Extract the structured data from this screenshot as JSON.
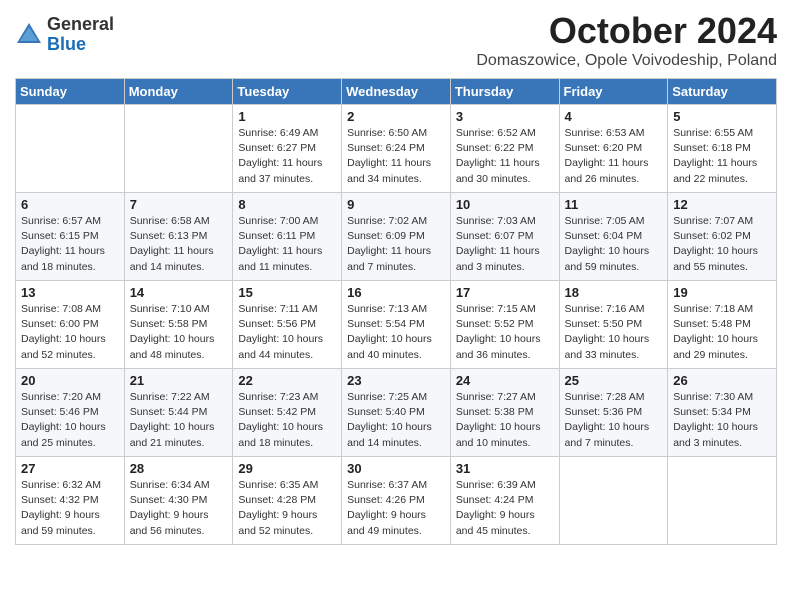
{
  "header": {
    "logo_general": "General",
    "logo_blue": "Blue",
    "month": "October 2024",
    "location": "Domaszowice, Opole Voivodeship, Poland"
  },
  "days_of_week": [
    "Sunday",
    "Monday",
    "Tuesday",
    "Wednesday",
    "Thursday",
    "Friday",
    "Saturday"
  ],
  "weeks": [
    [
      {
        "day": "",
        "info": ""
      },
      {
        "day": "",
        "info": ""
      },
      {
        "day": "1",
        "info": "Sunrise: 6:49 AM\nSunset: 6:27 PM\nDaylight: 11 hours and 37 minutes."
      },
      {
        "day": "2",
        "info": "Sunrise: 6:50 AM\nSunset: 6:24 PM\nDaylight: 11 hours and 34 minutes."
      },
      {
        "day": "3",
        "info": "Sunrise: 6:52 AM\nSunset: 6:22 PM\nDaylight: 11 hours and 30 minutes."
      },
      {
        "day": "4",
        "info": "Sunrise: 6:53 AM\nSunset: 6:20 PM\nDaylight: 11 hours and 26 minutes."
      },
      {
        "day": "5",
        "info": "Sunrise: 6:55 AM\nSunset: 6:18 PM\nDaylight: 11 hours and 22 minutes."
      }
    ],
    [
      {
        "day": "6",
        "info": "Sunrise: 6:57 AM\nSunset: 6:15 PM\nDaylight: 11 hours and 18 minutes."
      },
      {
        "day": "7",
        "info": "Sunrise: 6:58 AM\nSunset: 6:13 PM\nDaylight: 11 hours and 14 minutes."
      },
      {
        "day": "8",
        "info": "Sunrise: 7:00 AM\nSunset: 6:11 PM\nDaylight: 11 hours and 11 minutes."
      },
      {
        "day": "9",
        "info": "Sunrise: 7:02 AM\nSunset: 6:09 PM\nDaylight: 11 hours and 7 minutes."
      },
      {
        "day": "10",
        "info": "Sunrise: 7:03 AM\nSunset: 6:07 PM\nDaylight: 11 hours and 3 minutes."
      },
      {
        "day": "11",
        "info": "Sunrise: 7:05 AM\nSunset: 6:04 PM\nDaylight: 10 hours and 59 minutes."
      },
      {
        "day": "12",
        "info": "Sunrise: 7:07 AM\nSunset: 6:02 PM\nDaylight: 10 hours and 55 minutes."
      }
    ],
    [
      {
        "day": "13",
        "info": "Sunrise: 7:08 AM\nSunset: 6:00 PM\nDaylight: 10 hours and 52 minutes."
      },
      {
        "day": "14",
        "info": "Sunrise: 7:10 AM\nSunset: 5:58 PM\nDaylight: 10 hours and 48 minutes."
      },
      {
        "day": "15",
        "info": "Sunrise: 7:11 AM\nSunset: 5:56 PM\nDaylight: 10 hours and 44 minutes."
      },
      {
        "day": "16",
        "info": "Sunrise: 7:13 AM\nSunset: 5:54 PM\nDaylight: 10 hours and 40 minutes."
      },
      {
        "day": "17",
        "info": "Sunrise: 7:15 AM\nSunset: 5:52 PM\nDaylight: 10 hours and 36 minutes."
      },
      {
        "day": "18",
        "info": "Sunrise: 7:16 AM\nSunset: 5:50 PM\nDaylight: 10 hours and 33 minutes."
      },
      {
        "day": "19",
        "info": "Sunrise: 7:18 AM\nSunset: 5:48 PM\nDaylight: 10 hours and 29 minutes."
      }
    ],
    [
      {
        "day": "20",
        "info": "Sunrise: 7:20 AM\nSunset: 5:46 PM\nDaylight: 10 hours and 25 minutes."
      },
      {
        "day": "21",
        "info": "Sunrise: 7:22 AM\nSunset: 5:44 PM\nDaylight: 10 hours and 21 minutes."
      },
      {
        "day": "22",
        "info": "Sunrise: 7:23 AM\nSunset: 5:42 PM\nDaylight: 10 hours and 18 minutes."
      },
      {
        "day": "23",
        "info": "Sunrise: 7:25 AM\nSunset: 5:40 PM\nDaylight: 10 hours and 14 minutes."
      },
      {
        "day": "24",
        "info": "Sunrise: 7:27 AM\nSunset: 5:38 PM\nDaylight: 10 hours and 10 minutes."
      },
      {
        "day": "25",
        "info": "Sunrise: 7:28 AM\nSunset: 5:36 PM\nDaylight: 10 hours and 7 minutes."
      },
      {
        "day": "26",
        "info": "Sunrise: 7:30 AM\nSunset: 5:34 PM\nDaylight: 10 hours and 3 minutes."
      }
    ],
    [
      {
        "day": "27",
        "info": "Sunrise: 6:32 AM\nSunset: 4:32 PM\nDaylight: 9 hours and 59 minutes."
      },
      {
        "day": "28",
        "info": "Sunrise: 6:34 AM\nSunset: 4:30 PM\nDaylight: 9 hours and 56 minutes."
      },
      {
        "day": "29",
        "info": "Sunrise: 6:35 AM\nSunset: 4:28 PM\nDaylight: 9 hours and 52 minutes."
      },
      {
        "day": "30",
        "info": "Sunrise: 6:37 AM\nSunset: 4:26 PM\nDaylight: 9 hours and 49 minutes."
      },
      {
        "day": "31",
        "info": "Sunrise: 6:39 AM\nSunset: 4:24 PM\nDaylight: 9 hours and 45 minutes."
      },
      {
        "day": "",
        "info": ""
      },
      {
        "day": "",
        "info": ""
      }
    ]
  ]
}
